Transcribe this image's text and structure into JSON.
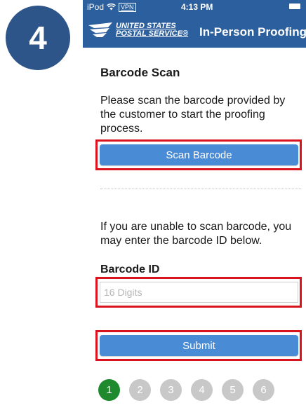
{
  "step_badge": "4",
  "status_bar": {
    "carrier": "iPod",
    "vpn": "VPN",
    "time": "4:13 PM"
  },
  "nav": {
    "logo_line1": "UNITED STATES",
    "logo_line2": "POSTAL SERVICE",
    "logo_mark": "®",
    "title": "In-Person Proofing"
  },
  "barcode": {
    "title": "Barcode Scan",
    "instructions": "Please scan the barcode provided by the customer to start the proofing process.",
    "scan_button_label": "Scan Barcode",
    "manual_instructions": "If you are unable to scan barcode, you may enter the barcode ID below.",
    "id_label": "Barcode ID",
    "id_placeholder": "16 Digits",
    "id_value": "",
    "submit_label": "Submit"
  },
  "progress_steps": [
    "1",
    "2",
    "3",
    "4",
    "5",
    "6"
  ],
  "progress_active_index": 0,
  "colors": {
    "header_blue": "#2c5f9e",
    "button_blue": "#4a8bd6",
    "highlight_red": "#d9141e",
    "active_step_green": "#1e8a2d",
    "inactive_step_gray": "#c8c8c8",
    "badge_navy": "#2d5589"
  },
  "icons": [
    "wifi-icon",
    "battery-icon",
    "usps-eagle-icon"
  ]
}
